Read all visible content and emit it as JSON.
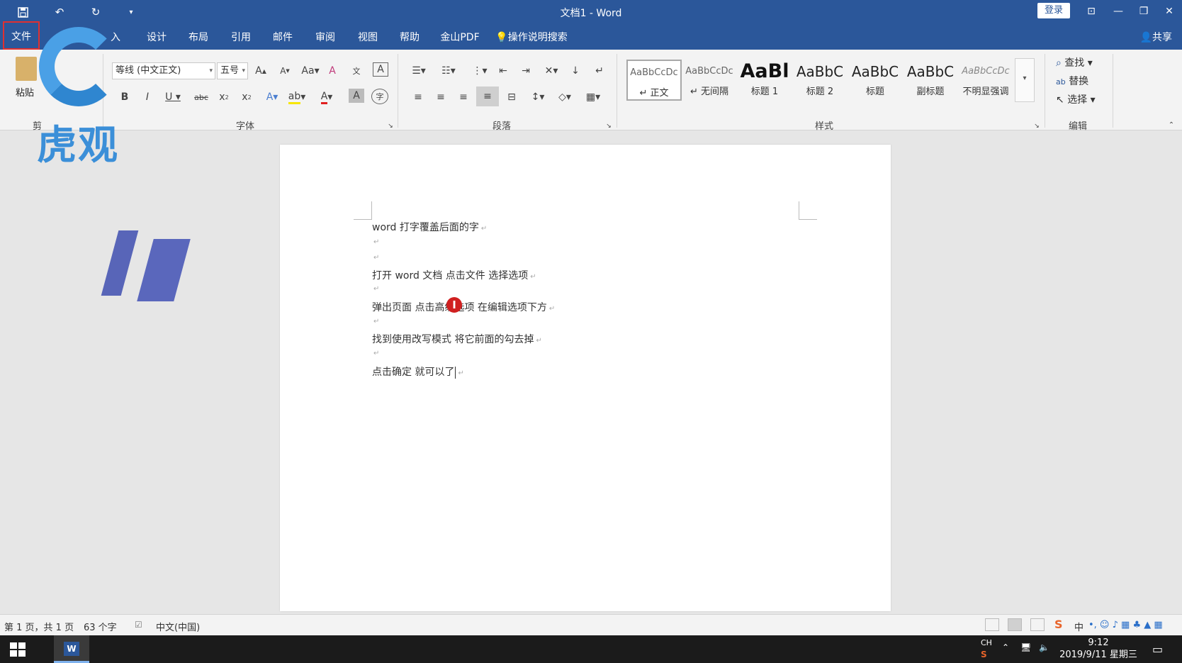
{
  "window": {
    "title": "文档1  -  Word",
    "login_label": "登录",
    "share_label": "共享"
  },
  "ribbon_tabs": [
    "文件",
    "设计",
    "布局",
    "引用",
    "邮件",
    "审阅",
    "视图",
    "帮助",
    "金山PDF"
  ],
  "search_tell": "操作说明搜索",
  "clipboard": {
    "paste_label": "粘贴",
    "group_label": "剪"
  },
  "font": {
    "font_name": "等线 (中文正文)",
    "font_size": "五号",
    "group_label": "字体"
  },
  "paragraph": {
    "group_label": "段落"
  },
  "styles": {
    "group_label": "样式",
    "items": [
      {
        "sample": "AaBbCcDc",
        "name": "↵ 正文"
      },
      {
        "sample": "AaBbCcDc",
        "name": "↵ 无间隔"
      },
      {
        "sample": "AaBl",
        "name": "标题 1"
      },
      {
        "sample": "AaBbC",
        "name": "标题 2"
      },
      {
        "sample": "AaBbC",
        "name": "标题"
      },
      {
        "sample": "AaBbC",
        "name": "副标题"
      },
      {
        "sample": "AaBbCcDc",
        "name": "不明显强调"
      }
    ]
  },
  "editing": {
    "group_label": "编辑",
    "find_label": "查找",
    "replace_label": "替换",
    "select_label": "选择"
  },
  "document": {
    "line1": "word 打字覆盖后面的字",
    "line2": "打开 word 文档    点击文件    选择选项",
    "line3": "弹出页面    点击高级选项    在编辑选项下方",
    "line4": "找到使用改写模式    将它前面的勾去掉",
    "line5": "点击确定    就可以了",
    "cursor_glyph": "I"
  },
  "watermark": {
    "text": "虎观"
  },
  "statusbar": {
    "page_info": "第 1 页，共 1 页",
    "word_count": "63 个字",
    "language": "中文(中国)"
  },
  "taskbar": {
    "ime": "CH",
    "time": "9:12",
    "date": "2019/9/11 星期三",
    "ime_mode": "中"
  }
}
